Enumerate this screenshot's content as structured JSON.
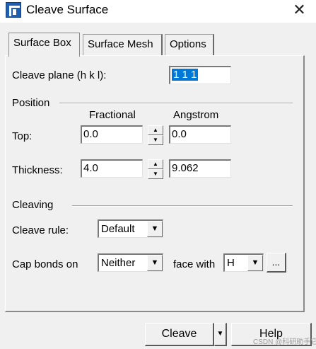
{
  "window": {
    "title": "Cleave Surface",
    "close_label": "✕"
  },
  "tabs": [
    {
      "label": "Surface Box"
    },
    {
      "label": "Surface Mesh"
    },
    {
      "label": "Options"
    }
  ],
  "surface_box": {
    "cleave_plane_label": "Cleave plane (h k l):",
    "cleave_plane_value": "1 1 1",
    "position_header": "Position",
    "col_fractional": "Fractional",
    "col_angstrom": "Angstrom",
    "top_label": "Top:",
    "top_fractional": "0.0",
    "top_angstrom": "0.0",
    "thickness_label": "Thickness:",
    "thickness_fractional": "4.0",
    "thickness_angstrom": "9.062",
    "cleaving_header": "Cleaving",
    "cleave_rule_label": "Cleave rule:",
    "cleave_rule_value": "Default",
    "cap_bonds_label": "Cap bonds on",
    "cap_bonds_value": "Neither",
    "face_with_label": "face with",
    "face_with_value": "H",
    "browse_label": "..."
  },
  "buttons": {
    "cleave": "Cleave",
    "help": "Help"
  },
  "watermark": "CSDN @科研助手它"
}
